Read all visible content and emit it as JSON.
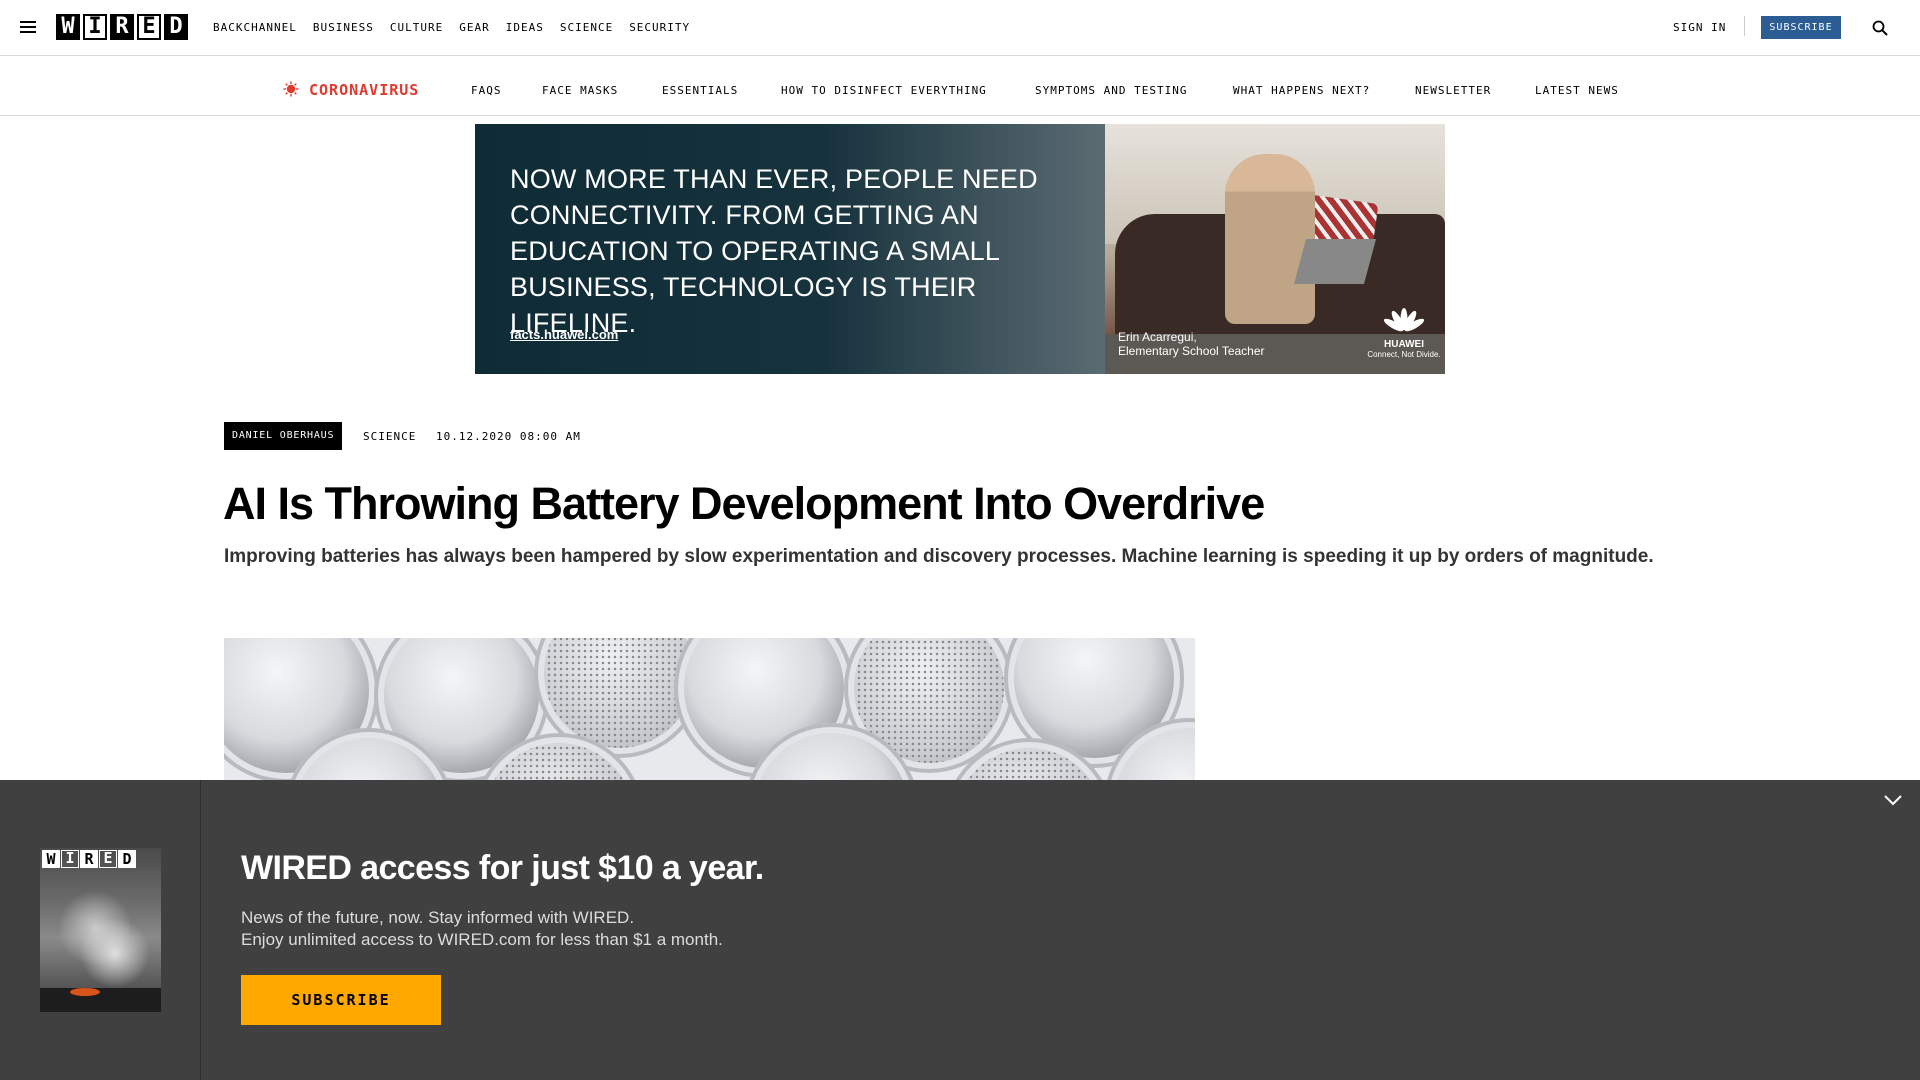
{
  "header": {
    "logo_letters": [
      "W",
      "I",
      "R",
      "E",
      "D"
    ],
    "nav": [
      "BACKCHANNEL",
      "BUSINESS",
      "CULTURE",
      "GEAR",
      "IDEAS",
      "SCIENCE",
      "SECURITY"
    ],
    "sign_in": "SIGN IN",
    "subscribe": "SUBSCRIBE"
  },
  "coronavirus_bar": {
    "label": "CORONAVIRUS",
    "accent_color": "#e03a2e",
    "links": [
      "FAQS",
      "FACE MASKS",
      "ESSENTIALS",
      "HOW TO DISINFECT EVERYTHING",
      "SYMPTOMS AND TESTING",
      "WHAT HAPPENS NEXT?",
      "NEWSLETTER",
      "LATEST NEWS"
    ]
  },
  "ad": {
    "headline": "NOW MORE THAN EVER, PEOPLE NEED CONNECTIVITY. FROM GETTING AN EDUCATION TO OPERATING A SMALL BUSINESS, TECHNOLOGY IS THEIR LIFELINE.",
    "link": "facts.huawei.com",
    "caption_name": "Erin Acarregui,",
    "caption_title": "Elementary School Teacher",
    "brand": "HUAWEI",
    "tagline": "Connect, Not Divide."
  },
  "article": {
    "author": "DANIEL OBERHAUS",
    "section": "SCIENCE",
    "date": "10.12.2020 08:00 AM",
    "title": "AI Is Throwing Battery Development Into Overdrive",
    "dek": "Improving batteries has always been hampered by slow experimentation and discovery processes. Machine learning is speeding it up by orders of magnitude."
  },
  "paywall": {
    "cover_logo": [
      "W",
      "I",
      "R",
      "E",
      "D"
    ],
    "title": "WIRED access for just $10 a year.",
    "line1": "News of the future, now. Stay informed with WIRED.",
    "line2": "Enjoy unlimited access to WIRED.com for less than $1 a month.",
    "button": "SUBSCRIBE",
    "button_color": "#ffa800"
  }
}
